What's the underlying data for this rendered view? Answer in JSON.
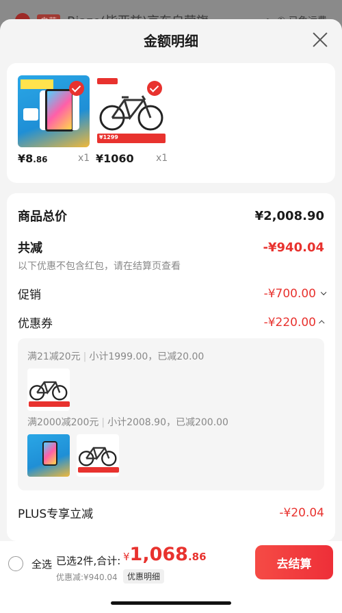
{
  "background": {
    "tag": "自营",
    "title": "Biaze(毕亚兹)京东自营旗",
    "right": "> ① 已免运费"
  },
  "sheet": {
    "title": "金额明细",
    "close_icon": "close-icon"
  },
  "products": [
    {
      "name": "switch-console",
      "price_int": "¥8",
      "price_dec": ".86",
      "qty": "x1"
    },
    {
      "name": "mountain-bike",
      "price_int": "¥1060",
      "price_dec": "",
      "qty": "x1",
      "tag_price": "¥1299"
    }
  ],
  "summary": {
    "goods_total_label": "商品总价",
    "goods_total_value": "¥2,008.90",
    "total_discount_label": "共减",
    "total_discount_value": "-¥940.04",
    "note": "以下优惠不包含红包，请在结算页查看",
    "promo_label": "促销",
    "promo_value": "-¥700.00",
    "coupon_label": "优惠券",
    "coupon_value": "-¥220.00",
    "plus_label": "PLUS专享立减",
    "plus_value": "-¥20.04"
  },
  "coupons": [
    {
      "rule": "满21减20元",
      "detail": "小计1999.00，已减20.00"
    },
    {
      "rule": "满2000减200元",
      "detail": "小计2008.90，已减200.00"
    }
  ],
  "bottom_bar": {
    "select_all": "全选",
    "selected": "已选2件,合计:",
    "currency": "¥",
    "total_int": "1,068",
    "total_dec": ".86",
    "saved": "优惠减:¥940.04",
    "detail_button": "优惠明细",
    "checkout": "去结算"
  },
  "colors": {
    "accent": "#e8322e",
    "sheet_bg": "#f4f4f4",
    "muted": "#888888"
  }
}
